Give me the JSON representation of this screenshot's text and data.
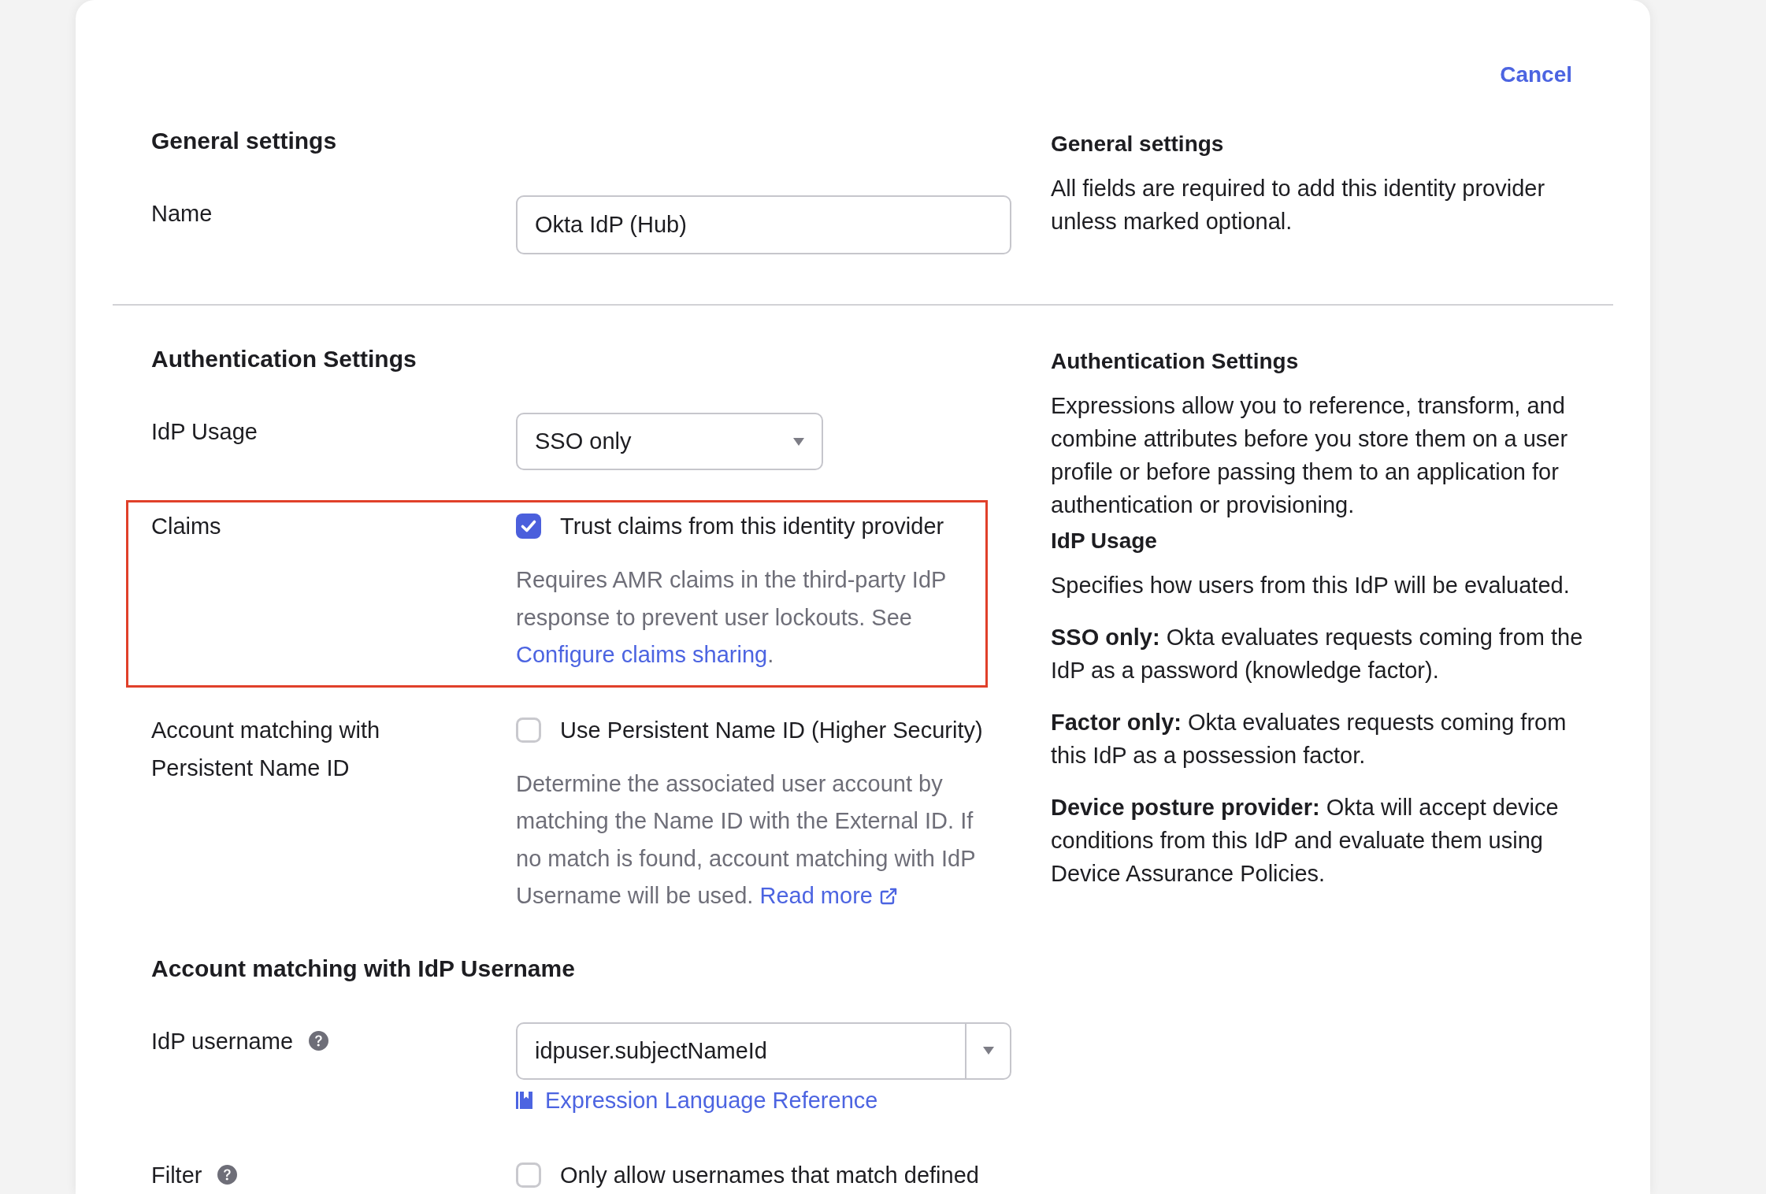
{
  "cancel": "Cancel",
  "sections": [
    {
      "title": "General settings",
      "fields": [
        {
          "kind": "text",
          "label": "Name",
          "value": "Okta IdP (Hub)"
        }
      ],
      "help": [
        {
          "kind": "heading",
          "text": "General settings"
        },
        {
          "kind": "paragraph",
          "text": "All fields are required to add this identity provider unless marked optional."
        }
      ]
    },
    {
      "title": "Authentication Settings",
      "fields": [
        {
          "kind": "select",
          "label": "IdP Usage",
          "value": "SSO only"
        },
        {
          "kind": "checkbox",
          "label": "Claims",
          "highlighted": true,
          "option": "Trust claims from this identity provider",
          "checked": true,
          "help": "Requires AMR claims in the third-party IdP response to prevent user lockouts. See",
          "link": {
            "label": "Configure claims sharing",
            "external": false
          },
          "after_link": "."
        },
        {
          "kind": "checkbox",
          "label": "Account matching with Persistent Name ID",
          "highlighted": false,
          "option": "Use Persistent Name ID (Higher Security)",
          "checked": false,
          "help": "Determine the associated user account by matching the Name ID with the External ID. If no match is found, account matching with IdP Username will be used.",
          "link": {
            "label": "Read more",
            "external": true
          }
        },
        {
          "kind": "heading",
          "label": "Account matching with IdP Username"
        },
        {
          "kind": "combobox",
          "label": "IdP username",
          "info": true,
          "value": "idpuser.subjectNameId",
          "reference": "Expression Language Reference"
        },
        {
          "kind": "checkbox",
          "label": "Filter",
          "info": true,
          "highlighted": false,
          "option": "Only allow usernames that match defined",
          "checked": false
        }
      ],
      "help": [
        {
          "kind": "heading",
          "text": "Authentication Settings"
        },
        {
          "kind": "paragraph",
          "text": "Expressions allow you to reference, transform, and combine attributes before you store them on a user profile or before passing them to an application for authentication or provisioning."
        },
        {
          "kind": "heading",
          "text": "IdP Usage"
        },
        {
          "kind": "paragraph",
          "text": "Specifies how users from this IdP will be evaluated."
        },
        {
          "kind": "paragraph",
          "text": "**SSO only:** Okta evaluates requests coming from the IdP as a password (knowledge factor)."
        },
        {
          "kind": "paragraph",
          "text": "**Factor only:** Okta evaluates requests coming from this IdP as a possession factor."
        },
        {
          "kind": "paragraph",
          "text": "**Device posture provider:** Okta will accept device conditions from this IdP and evaluate them using Device Assurance Policies."
        }
      ]
    }
  ]
}
